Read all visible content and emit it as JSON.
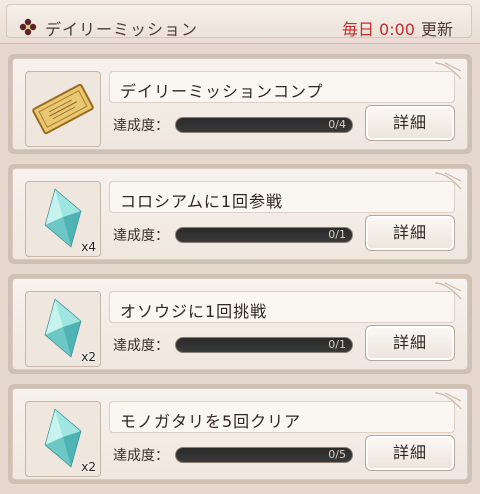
{
  "header": {
    "title": "デイリーミッション",
    "reset_day": "毎日 0:00",
    "reset_label": "更新"
  },
  "colors": {
    "accent_red": "#c42d2d",
    "progress_fill": "#d8a34a"
  },
  "missions": [
    {
      "title": "デイリーミッションコンプ",
      "progress_label": "達成度：",
      "progress_text": "0/4",
      "progress": 0,
      "detail_label": "詳細",
      "reward_icon": "ticket-icon",
      "reward_qty": ""
    },
    {
      "title": "コロシアムに1回参戦",
      "progress_label": "達成度：",
      "progress_text": "0/1",
      "progress": 0,
      "detail_label": "詳細",
      "reward_icon": "crystal-icon",
      "reward_qty": "x4"
    },
    {
      "title": "オソウジに1回挑戦",
      "progress_label": "達成度：",
      "progress_text": "0/1",
      "progress": 0,
      "detail_label": "詳細",
      "reward_icon": "crystal-icon",
      "reward_qty": "x2"
    },
    {
      "title": "モノガタリを5回クリア",
      "progress_label": "達成度：",
      "progress_text": "0/5",
      "progress": 0,
      "detail_label": "詳細",
      "reward_icon": "crystal-icon",
      "reward_qty": "x2"
    }
  ]
}
